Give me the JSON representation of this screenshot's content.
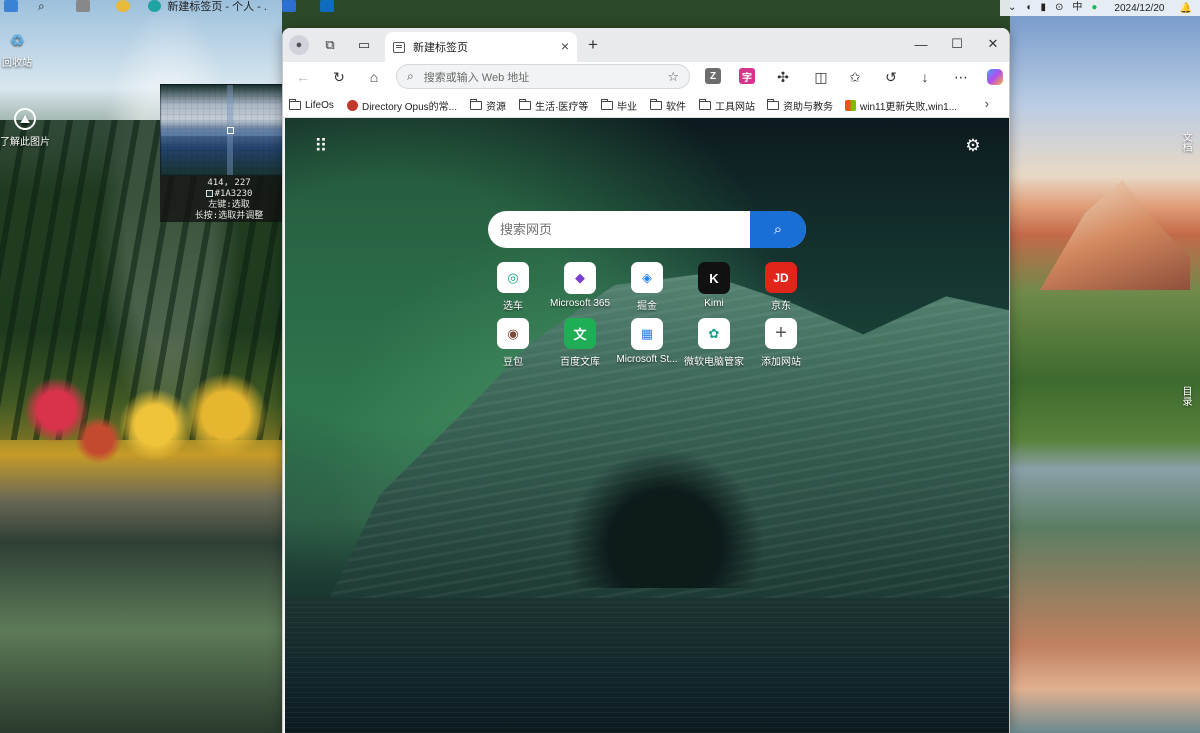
{
  "taskbar": {
    "active_window_title": "新建标签页 - 个人 - ...",
    "tray_input_method": "中",
    "date": "2024/12/20"
  },
  "desktop": {
    "icons": [
      {
        "label": "回收站",
        "icon": "recycle-bin-icon"
      },
      {
        "label": "了解此图片",
        "icon": "learn-about-picture-icon"
      }
    ],
    "right_labels": [
      "文档",
      "目录"
    ]
  },
  "magnifier": {
    "coords": "414, 227",
    "color_hex": "#1A3230",
    "hint_left_click": "左键:选取",
    "hint_long_press": "长按:选取并调整"
  },
  "browser": {
    "tab": {
      "title": "新建标签页"
    },
    "address_bar": {
      "placeholder": "搜索或输入 Web 地址",
      "value": ""
    },
    "bookmarks": [
      {
        "label": "LifeOs",
        "type": "folder"
      },
      {
        "label": "Directory Opus的常...",
        "type": "site",
        "color": "#c0392b"
      },
      {
        "label": "资源",
        "type": "folder"
      },
      {
        "label": "生活·医疗等",
        "type": "folder"
      },
      {
        "label": "毕业",
        "type": "folder"
      },
      {
        "label": "软件",
        "type": "folder"
      },
      {
        "label": "工具网站",
        "type": "folder"
      },
      {
        "label": "资助与教务",
        "type": "folder"
      },
      {
        "label": "win11更新失败,win1...",
        "type": "site",
        "color": "#f25022"
      }
    ],
    "extensions": [
      {
        "name": "z-extension-icon",
        "glyph": "Z",
        "color": "#6d6d6d"
      },
      {
        "name": "pink-extension-icon",
        "glyph": "字",
        "color": "#d6368a"
      }
    ],
    "window_controls": {
      "minimize": "—",
      "maximize": "☐",
      "close": "✕"
    }
  },
  "ntp": {
    "search": {
      "placeholder": "搜索网页"
    },
    "tiles": [
      {
        "label": "选车",
        "glyph": "◎",
        "color": "#10a37f"
      },
      {
        "label": "Microsoft 365",
        "glyph": "◆",
        "color": "#7b3fd4"
      },
      {
        "label": "掘金",
        "glyph": "◈",
        "color": "#1e80ff"
      },
      {
        "label": "Kimi",
        "glyph": "K",
        "color": "#111111"
      },
      {
        "label": "京东",
        "glyph": "JD",
        "color": "#e1251b"
      },
      {
        "label": "豆包",
        "glyph": "◉",
        "color": "#7a4b3a"
      },
      {
        "label": "百度文库",
        "glyph": "文",
        "color": "#1fae56"
      },
      {
        "label": "Microsoft St...",
        "glyph": "▦",
        "color": "#2b7de0"
      },
      {
        "label": "微软电脑管家",
        "glyph": "✿",
        "color": "#1ca08a"
      },
      {
        "label": "添加网站",
        "glyph": "+",
        "color": "#555555"
      }
    ]
  }
}
